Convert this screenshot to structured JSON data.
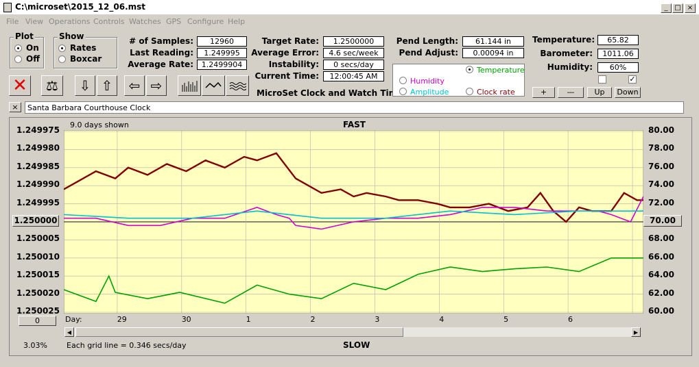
{
  "window": {
    "title": "C:\\microset\\2015_12_06.mst",
    "minimize": "_",
    "maximize": "□",
    "close": "×"
  },
  "menu": [
    "File",
    "View",
    "Operations",
    "Controls",
    "Watches",
    "GPS",
    "Configure",
    "Help"
  ],
  "plot_group": {
    "title": "Plot",
    "on": "On",
    "off": "Off",
    "selected": "On"
  },
  "show_group": {
    "title": "Show",
    "rates": "Rates",
    "boxcar": "Boxcar",
    "selected": "Rates"
  },
  "stats": {
    "samples_label": "# of Samples:",
    "samples": "12960",
    "last_label": "Last Reading:",
    "last": "1.249995",
    "avg_label": "Average Rate:",
    "avg": "1.2499904",
    "target_label": "Target Rate:",
    "target": "1.2500000",
    "avgerr_label": "Average Error:",
    "avgerr": "4.6 sec/week",
    "instab_label": "Instability:",
    "instab": "0 secs/day",
    "time_label": "Current Time:",
    "time": "12:00:45 AM",
    "pendlen_label": "Pend Length:",
    "pendlen": "61.144 in",
    "pendadj_label": "Pend Adjust:",
    "pendadj": "0.00094 in",
    "temp_label": "Temperature:",
    "temp": "65.82",
    "baro_label": "Barometer:",
    "baro": "1011.06",
    "hum_label": "Humidity:",
    "hum": "60%"
  },
  "app_title": "MicroSet Clock and Watch Timer",
  "sensor_select": {
    "temperature": "Temperature",
    "humidity": "Humidity",
    "amplitude": "Amplitude",
    "clockrate": "Clock rate",
    "selected": "Temperature",
    "colors": {
      "temperature": "#00a000",
      "humidity": "#d000d0",
      "amplitude": "#00c0d0",
      "clockrate": "#800000"
    }
  },
  "scale_buttons": {
    "plus": "+",
    "minus": "—",
    "up": "Up",
    "down": "Down"
  },
  "clock_name": "Santa Barbara Courthouse Clock",
  "clock_close": "×",
  "chart": {
    "days_shown": "9.0 days shown",
    "top_label": "FAST",
    "bottom_label": "SLOW",
    "grid_note": "Each grid line = 0.346 secs/day",
    "percent": "3.03%",
    "day_label": "Day:",
    "center_left": "1.250000",
    "center_right": "70.00",
    "zero_btn": "0"
  },
  "chart_data": {
    "type": "line",
    "left_axis_ticks": [
      "1.249975",
      "1.249980",
      "1.249985",
      "1.249990",
      "1.249995",
      "1.250000",
      "1.250005",
      "1.250010",
      "1.250015",
      "1.250020",
      "1.250025"
    ],
    "right_axis_ticks": [
      "80.00",
      "78.00",
      "76.00",
      "74.00",
      "72.00",
      "70.00",
      "68.00",
      "66.00",
      "64.00",
      "62.00",
      "60.00"
    ],
    "x_ticks": [
      "29",
      "30",
      "1",
      "2",
      "3",
      "4",
      "5",
      "6"
    ],
    "ylim_left": [
      1.249975,
      1.250025
    ],
    "ylim_right": [
      60,
      80
    ],
    "xlim_days": [
      0,
      9
    ],
    "series": [
      {
        "key": "clockrate",
        "color": "#800000",
        "axis": "left",
        "x": [
          0.0,
          0.2,
          0.5,
          0.8,
          1.0,
          1.3,
          1.6,
          1.9,
          2.2,
          2.5,
          2.8,
          3.0,
          3.3,
          3.6,
          3.8,
          4.0,
          4.3,
          4.5,
          4.7,
          5.0,
          5.2,
          5.5,
          5.8,
          6.0,
          6.3,
          6.6,
          6.9,
          7.2,
          7.4,
          7.6,
          7.8,
          8.0,
          8.2,
          8.5,
          8.7,
          8.9,
          9.0
        ],
        "y": [
          1.249991,
          1.249989,
          1.249986,
          1.249988,
          1.249985,
          1.249987,
          1.249984,
          1.249986,
          1.249983,
          1.249985,
          1.249982,
          1.249983,
          1.249981,
          1.249988,
          1.24999,
          1.249992,
          1.249991,
          1.249993,
          1.249992,
          1.249993,
          1.249994,
          1.249994,
          1.249995,
          1.249996,
          1.249996,
          1.249995,
          1.249997,
          1.249996,
          1.249992,
          1.249997,
          1.25,
          1.249996,
          1.249997,
          1.249997,
          1.249992,
          1.249994,
          1.249994
        ]
      },
      {
        "key": "humidity",
        "color": "#d000d0",
        "axis": "left",
        "x": [
          0.0,
          0.5,
          1.0,
          1.5,
          2.0,
          2.5,
          3.0,
          3.3,
          3.5,
          3.6,
          4.0,
          4.5,
          5.0,
          5.5,
          6.0,
          6.5,
          7.0,
          7.5,
          8.0,
          8.3,
          8.5,
          8.8,
          9.0
        ],
        "y": [
          1.249999,
          1.249999,
          1.250001,
          1.250001,
          1.249999,
          1.249999,
          1.249996,
          1.249998,
          1.249999,
          1.250001,
          1.250002,
          1.25,
          1.249999,
          1.249999,
          1.249998,
          1.249996,
          1.249996,
          1.249997,
          1.249997,
          1.249997,
          1.249998,
          1.25,
          1.249993
        ]
      },
      {
        "key": "amplitude",
        "color": "#00c0d0",
        "axis": "left",
        "x": [
          0.0,
          1.0,
          2.0,
          3.0,
          4.0,
          5.0,
          6.0,
          7.0,
          8.0,
          9.0
        ],
        "y": [
          1.249998,
          1.249999,
          1.249999,
          1.249997,
          1.249999,
          1.249999,
          1.249997,
          1.249998,
          1.249997,
          1.249997
        ]
      },
      {
        "key": "temperature",
        "color": "#00a000",
        "axis": "right",
        "x": [
          0.0,
          0.5,
          0.7,
          0.8,
          1.3,
          1.8,
          2.5,
          3.0,
          3.5,
          4.0,
          4.5,
          5.0,
          5.5,
          6.0,
          6.5,
          7.0,
          7.5,
          8.0,
          8.5,
          9.0
        ],
        "y": [
          62.5,
          61.2,
          64.0,
          62.2,
          61.5,
          62.2,
          61.0,
          63.0,
          62.0,
          61.5,
          63.2,
          62.5,
          64.2,
          65.0,
          64.5,
          64.8,
          65.0,
          64.5,
          66.0,
          66.0
        ]
      }
    ]
  }
}
